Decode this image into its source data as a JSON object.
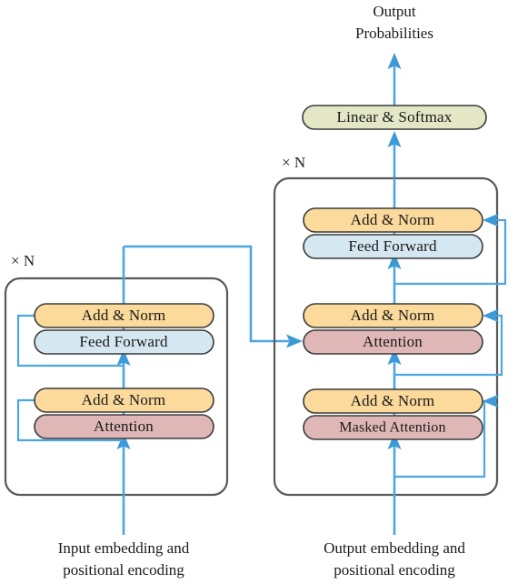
{
  "diagram": {
    "title": "Transformer encoder-decoder architecture",
    "colors": {
      "add_norm_fill": "#FBDA9B",
      "feed_forward_fill": "#D5E7F1",
      "attention_fill": "#DEB7B6",
      "linear_softmax_fill": "#E3E7C6",
      "arrow_blue": "#4da6e0",
      "frame_gray": "#59595b",
      "text_dark": "#1a1a1a"
    },
    "top": {
      "output_probabilities_line1": "Output",
      "output_probabilities_line2": "Probabilities",
      "linear_softmax_label": "Linear & Softmax"
    },
    "encoder": {
      "repeat_label": "× N",
      "caption_line1": "Input embedding and",
      "caption_line2": "positional encoding",
      "sublayers": [
        {
          "name": "add-norm-upper",
          "label": "Add & Norm",
          "fill_key": "add_norm_fill"
        },
        {
          "name": "feed-forward",
          "label": "Feed Forward",
          "fill_key": "feed_forward_fill"
        },
        {
          "name": "add-norm-lower",
          "label": "Add & Norm",
          "fill_key": "add_norm_fill"
        },
        {
          "name": "attention",
          "label": "Attention",
          "fill_key": "attention_fill"
        }
      ]
    },
    "decoder": {
      "repeat_label": "× N",
      "caption_line1": "Output embedding and",
      "caption_line2": "positional encoding",
      "sublayers": [
        {
          "name": "add-norm-top",
          "label": "Add & Norm",
          "fill_key": "add_norm_fill"
        },
        {
          "name": "feed-forward",
          "label": "Feed Forward",
          "fill_key": "feed_forward_fill"
        },
        {
          "name": "add-norm-middle",
          "label": "Add & Norm",
          "fill_key": "add_norm_fill"
        },
        {
          "name": "cross-attention",
          "label": "Attention",
          "fill_key": "attention_fill"
        },
        {
          "name": "add-norm-bottom",
          "label": "Add & Norm",
          "fill_key": "add_norm_fill"
        },
        {
          "name": "masked-attention",
          "label": "Masked Attention",
          "fill_key": "attention_fill"
        }
      ]
    }
  }
}
